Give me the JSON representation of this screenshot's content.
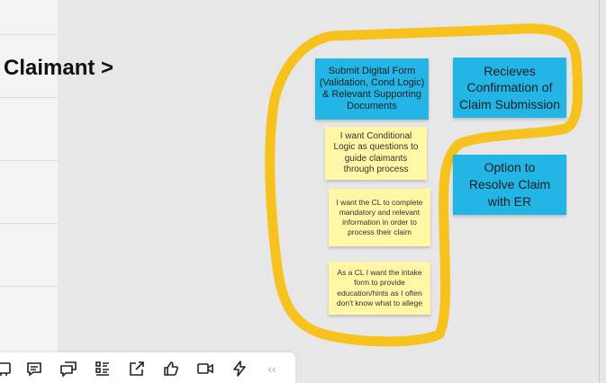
{
  "board": {
    "frame_title": "Claimant >",
    "outline_color": "#f7c21e"
  },
  "stickies": {
    "submit_form": "Submit Digital Form (Validation, Cond Logic) & Relevant Supporting Documents",
    "receives_confirmation": "Recieves Confirmation of Claim Submission",
    "option_resolve": "Option to Resolve Claim with ER",
    "note_conditional_logic": "I want Conditional Logic as questions to guide claimants through process",
    "note_cl_complete": "I want the CL to complete mandatory and relevant information in order to process their claim",
    "note_intake_form": "As a CL I want the intake form to provide education/hints as I often don't know what to allege"
  },
  "colors": {
    "blue_sticky": "#22b5e6",
    "yellow_sticky": "#fff6a6"
  },
  "toolbar": {
    "icons": [
      "frame-icon",
      "comment-icon",
      "chat-icon",
      "list-icon",
      "share-icon",
      "thumbs-up-icon",
      "video-icon",
      "lightning-icon"
    ],
    "collapse_label": "‹‹"
  }
}
